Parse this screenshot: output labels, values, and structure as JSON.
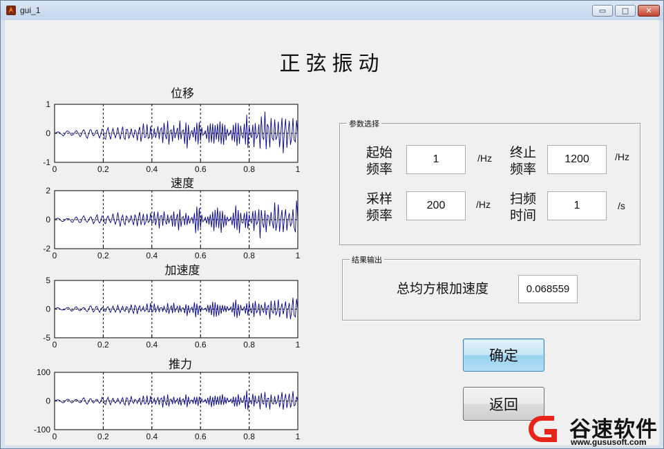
{
  "window": {
    "title": "gui_1",
    "minimize_glyph": "▭",
    "maximize_glyph": "□",
    "close_glyph": "✕"
  },
  "main_title": "正弦振动",
  "chart_data": [
    {
      "type": "line",
      "title": "位移",
      "xlim": [
        0,
        1
      ],
      "ylim": [
        -1,
        1
      ],
      "xticks": [
        "0",
        "0.2",
        "0.4",
        "0.6",
        "0.8",
        "1"
      ],
      "yticks": [
        "1",
        "0",
        "-1"
      ],
      "grid": "dashed vertical at x ticks, dashed zero line",
      "color": "#00008b",
      "series": [
        {
          "x_range": [
            0,
            1
          ],
          "envelope_start": 0.05,
          "envelope_end": 0.95
        }
      ]
    },
    {
      "type": "line",
      "title": "速度",
      "xlim": [
        0,
        1
      ],
      "ylim": [
        -2,
        2
      ],
      "xticks": [
        "0",
        "0.2",
        "0.4",
        "0.6",
        "0.8",
        "1"
      ],
      "yticks": [
        "2",
        "0",
        "-2"
      ],
      "grid": "dashed vertical at x ticks, dashed zero line",
      "color": "#00008b",
      "series": [
        {
          "x_range": [
            0,
            1
          ],
          "envelope_start": 0.1,
          "envelope_end": 1.6
        }
      ]
    },
    {
      "type": "line",
      "title": "加速度",
      "xlim": [
        0,
        1
      ],
      "ylim": [
        -5,
        5
      ],
      "xticks": [
        "0",
        "0.2",
        "0.4",
        "0.6",
        "0.8",
        "1"
      ],
      "yticks": [
        "5",
        "0",
        "-5"
      ],
      "grid": "dashed vertical at x ticks, dashed zero line",
      "color": "#00008b",
      "series": [
        {
          "x_range": [
            0,
            1
          ],
          "envelope_start": 0.3,
          "envelope_end": 2.4
        }
      ]
    },
    {
      "type": "line",
      "title": "推力",
      "xlim": [
        0,
        1
      ],
      "ylim": [
        -100,
        100
      ],
      "xticks": [
        "0",
        "0.2",
        "0.4",
        "0.6",
        "0.8",
        "1"
      ],
      "yticks": [
        "100",
        "0",
        "-100"
      ],
      "grid": "dashed vertical at x ticks, dashed zero line",
      "color": "#00008b",
      "series": [
        {
          "x_range": [
            0,
            1
          ],
          "envelope_start": 6,
          "envelope_end": 48
        }
      ]
    }
  ],
  "params_panel": {
    "title": "参数选择",
    "start_freq": {
      "label_line1": "起始",
      "label_line2": "频率",
      "value": "1",
      "unit": "/Hz"
    },
    "end_freq": {
      "label_line1": "终止",
      "label_line2": "频率",
      "value": "1200",
      "unit": "/Hz"
    },
    "sample_freq": {
      "label_line1": "采样",
      "label_line2": "频率",
      "value": "200",
      "unit": "/Hz"
    },
    "sweep_time": {
      "label_line1": "扫频",
      "label_line2": "时间",
      "value": "1",
      "unit": "/s"
    }
  },
  "result_panel": {
    "title": "结果输出",
    "rms_label": "总均方根加速度",
    "rms_value": "0.068559"
  },
  "buttons": {
    "confirm": "确定",
    "back": "返回"
  },
  "watermark": {
    "brand": "谷速软件",
    "url": "www.gususoft.com",
    "logo_color": "#e8231a"
  }
}
